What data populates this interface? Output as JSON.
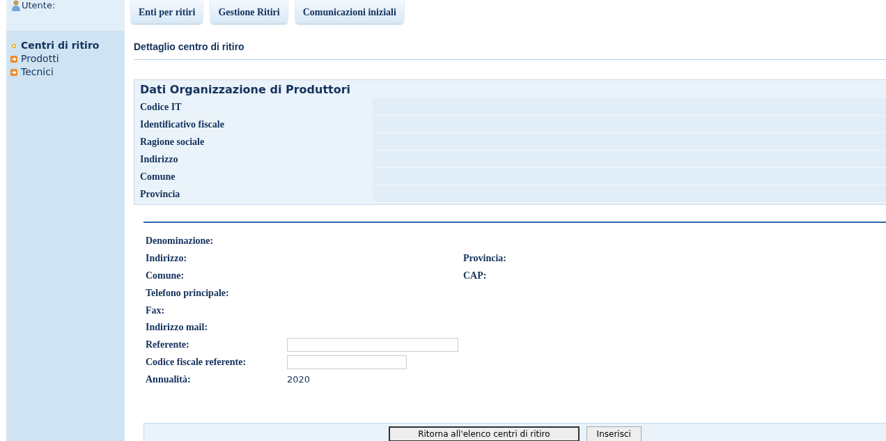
{
  "sidebar": {
    "user_label": "Utente:",
    "items": [
      {
        "label": "Centri di ritiro",
        "selected": true
      },
      {
        "label": "Prodotti",
        "selected": false
      },
      {
        "label": "Tecnici",
        "selected": false
      }
    ]
  },
  "tabs": [
    {
      "label": "Enti per ritiri"
    },
    {
      "label": "Gestione Ritiri"
    },
    {
      "label": "Comunicazioni iniziali"
    }
  ],
  "page_title": "Dettaglio centro di ritiro",
  "organization": {
    "title": "Dati Organizzazione di Produttori",
    "rows": [
      {
        "label": "Codice IT"
      },
      {
        "label": "Identificativo fiscale"
      },
      {
        "label": "Ragione sociale"
      },
      {
        "label": "Indirizzo"
      },
      {
        "label": "Comune"
      },
      {
        "label": "Provincia"
      }
    ]
  },
  "form": {
    "rows": [
      {
        "kind": "text",
        "label": "Denominazione:"
      },
      {
        "kind": "text",
        "label": "Indirizzo:",
        "side_label": "Provincia:"
      },
      {
        "kind": "text",
        "label": "Comune:",
        "side_label": "CAP:"
      },
      {
        "kind": "text",
        "label": "Telefono principale:"
      },
      {
        "kind": "text",
        "label": "Fax:"
      },
      {
        "kind": "text",
        "label": "Indirizzo mail:"
      },
      {
        "kind": "input",
        "label": "Referente:"
      },
      {
        "kind": "input",
        "label": "Codice fiscale referente:"
      },
      {
        "kind": "text",
        "label": "Annualità:",
        "value": "2020"
      }
    ]
  },
  "buttons": [
    {
      "label": "Ritorna all'elenco centri di ritiro",
      "primary": true
    },
    {
      "label": "Inserisci",
      "primary": false
    }
  ]
}
